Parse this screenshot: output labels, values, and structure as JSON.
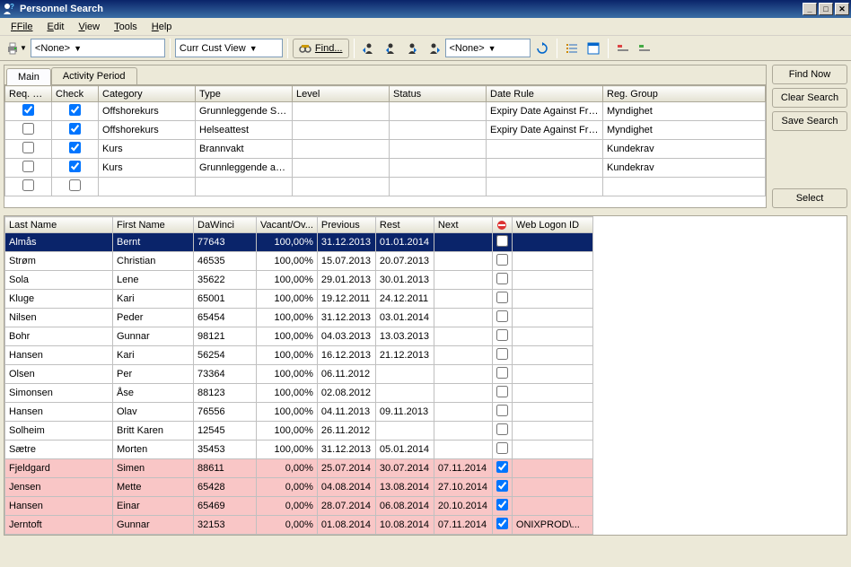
{
  "window": {
    "title": "Personnel Search"
  },
  "menu": {
    "file": "File",
    "edit": "Edit",
    "view": "View",
    "tools": "Tools",
    "help": "Help"
  },
  "toolbar": {
    "combo1": "<None>",
    "combo2": "Curr Cust View",
    "find_label": "Find...",
    "combo3": "<None>"
  },
  "buttons": {
    "find_now": "Find Now",
    "clear_search": "Clear Search",
    "save_search": "Save Search",
    "select": "Select"
  },
  "tabs": {
    "main": "Main",
    "activity": "Activity Period"
  },
  "criteria": {
    "headers": {
      "req_met": "Req. Met",
      "check": "Check",
      "category": "Category",
      "type": "Type",
      "level": "Level",
      "status": "Status",
      "date_rule": "Date Rule",
      "reg_group": "Reg. Group"
    },
    "rows": [
      {
        "req_met": true,
        "check": true,
        "category": "Offshorekurs",
        "type": "Grunnleggende Sik...",
        "level": "",
        "status": "",
        "date_rule": "Expiry Date Against From...",
        "reg_group": "Myndighet"
      },
      {
        "req_met": false,
        "check": true,
        "category": "Offshorekurs",
        "type": "Helseattest",
        "level": "",
        "status": "",
        "date_rule": "Expiry Date Against From...",
        "reg_group": "Myndighet"
      },
      {
        "req_met": false,
        "check": true,
        "category": "Kurs",
        "type": "Brannvakt",
        "level": "",
        "status": "",
        "date_rule": "",
        "reg_group": "Kundekrav"
      },
      {
        "req_met": false,
        "check": true,
        "category": "Kurs",
        "type": "Grunnleggende arb...",
        "level": "",
        "status": "",
        "date_rule": "",
        "reg_group": "Kundekrav"
      },
      {
        "req_met": false,
        "check": false,
        "category": "",
        "type": "",
        "level": "",
        "status": "",
        "date_rule": "",
        "reg_group": ""
      }
    ]
  },
  "results": {
    "headers": {
      "last": "Last Name",
      "first": "First Name",
      "dawinci": "DaWinci",
      "vacant": "Vacant/Ov...",
      "previous": "Previous",
      "rest": "Rest",
      "next": "Next",
      "logon": "Web Logon ID"
    },
    "rows": [
      {
        "sel": true,
        "pink": false,
        "last": "Almås",
        "first": "Bernt",
        "dawinci": "77643",
        "vacant": "100,00%",
        "previous": "31.12.2013",
        "rest": "01.01.2014",
        "next": "",
        "flag": false,
        "logon": ""
      },
      {
        "sel": false,
        "pink": false,
        "last": "Strøm",
        "first": "Christian",
        "dawinci": "46535",
        "vacant": "100,00%",
        "previous": "15.07.2013",
        "rest": "20.07.2013",
        "next": "",
        "flag": false,
        "logon": ""
      },
      {
        "sel": false,
        "pink": false,
        "last": "Sola",
        "first": "Lene",
        "dawinci": "35622",
        "vacant": "100,00%",
        "previous": "29.01.2013",
        "rest": "30.01.2013",
        "next": "",
        "flag": false,
        "logon": ""
      },
      {
        "sel": false,
        "pink": false,
        "last": "Kluge",
        "first": "Kari",
        "dawinci": "65001",
        "vacant": "100,00%",
        "previous": "19.12.2011",
        "rest": "24.12.2011",
        "next": "",
        "flag": false,
        "logon": ""
      },
      {
        "sel": false,
        "pink": false,
        "last": "Nilsen",
        "first": "Peder",
        "dawinci": "65454",
        "vacant": "100,00%",
        "previous": "31.12.2013",
        "rest": "03.01.2014",
        "next": "",
        "flag": false,
        "logon": ""
      },
      {
        "sel": false,
        "pink": false,
        "last": "Bohr",
        "first": "Gunnar",
        "dawinci": "98121",
        "vacant": "100,00%",
        "previous": "04.03.2013",
        "rest": "13.03.2013",
        "next": "",
        "flag": false,
        "logon": ""
      },
      {
        "sel": false,
        "pink": false,
        "last": "Hansen",
        "first": "Kari",
        "dawinci": "56254",
        "vacant": "100,00%",
        "previous": "16.12.2013",
        "rest": "21.12.2013",
        "next": "",
        "flag": false,
        "logon": ""
      },
      {
        "sel": false,
        "pink": false,
        "last": "Olsen",
        "first": "Per",
        "dawinci": "73364",
        "vacant": "100,00%",
        "previous": "06.11.2012",
        "rest": "",
        "next": "",
        "flag": false,
        "logon": ""
      },
      {
        "sel": false,
        "pink": false,
        "last": "Simonsen",
        "first": "Åse",
        "dawinci": "88123",
        "vacant": "100,00%",
        "previous": "02.08.2012",
        "rest": "",
        "next": "",
        "flag": false,
        "logon": ""
      },
      {
        "sel": false,
        "pink": false,
        "last": "Hansen",
        "first": "Olav",
        "dawinci": "76556",
        "vacant": "100,00%",
        "previous": "04.11.2013",
        "rest": "09.11.2013",
        "next": "",
        "flag": false,
        "logon": ""
      },
      {
        "sel": false,
        "pink": false,
        "last": "Solheim",
        "first": "Britt Karen",
        "dawinci": "12545",
        "vacant": "100,00%",
        "previous": "26.11.2012",
        "rest": "",
        "next": "",
        "flag": false,
        "logon": ""
      },
      {
        "sel": false,
        "pink": false,
        "last": "Sætre",
        "first": "Morten",
        "dawinci": "35453",
        "vacant": "100,00%",
        "previous": "31.12.2013",
        "rest": "05.01.2014",
        "next": "",
        "flag": false,
        "logon": ""
      },
      {
        "sel": false,
        "pink": true,
        "last": "Fjeldgard",
        "first": "Simen",
        "dawinci": "88611",
        "vacant": "0,00%",
        "previous": "25.07.2014",
        "rest": "30.07.2014",
        "next": "07.11.2014",
        "flag": true,
        "logon": ""
      },
      {
        "sel": false,
        "pink": true,
        "last": "Jensen",
        "first": "Mette",
        "dawinci": "65428",
        "vacant": "0,00%",
        "previous": "04.08.2014",
        "rest": "13.08.2014",
        "next": "27.10.2014",
        "flag": true,
        "logon": ""
      },
      {
        "sel": false,
        "pink": true,
        "last": "Hansen",
        "first": "Einar",
        "dawinci": "65469",
        "vacant": "0,00%",
        "previous": "28.07.2014",
        "rest": "06.08.2014",
        "next": "20.10.2014",
        "flag": true,
        "logon": ""
      },
      {
        "sel": false,
        "pink": true,
        "last": "Jerntoft",
        "first": "Gunnar",
        "dawinci": "32153",
        "vacant": "0,00%",
        "previous": "01.08.2014",
        "rest": "10.08.2014",
        "next": "07.11.2014",
        "flag": true,
        "logon": "ONIXPROD\\..."
      }
    ]
  }
}
